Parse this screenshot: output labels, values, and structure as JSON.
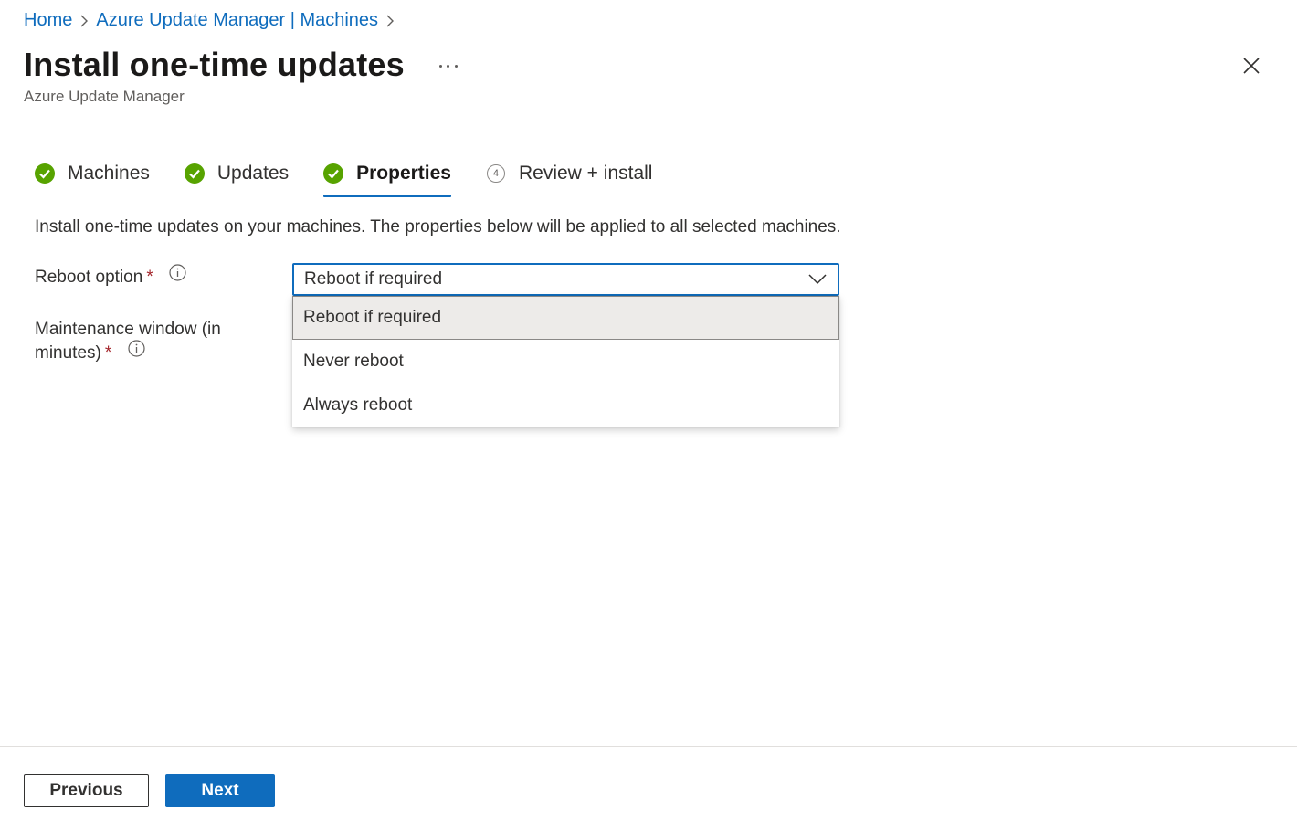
{
  "breadcrumb": {
    "items": [
      "Home",
      "Azure Update Manager | Machines"
    ]
  },
  "header": {
    "title": "Install one-time updates",
    "subtitle": "Azure Update Manager"
  },
  "steps": [
    {
      "label": "Machines",
      "status": "complete"
    },
    {
      "label": "Updates",
      "status": "complete"
    },
    {
      "label": "Properties",
      "status": "active"
    },
    {
      "label": "Review + install",
      "status": "pending",
      "number": "4"
    }
  ],
  "intro": "Install one-time updates on your machines. The properties below will be applied to all selected machines.",
  "form": {
    "reboot_label": "Reboot option",
    "maintenance_label_line1": "Maintenance window (in",
    "maintenance_label_line2": "minutes)",
    "required_mark": "*",
    "reboot_value": "Reboot if required",
    "reboot_options": [
      "Reboot if required",
      "Never reboot",
      "Always reboot"
    ]
  },
  "footer": {
    "previous_label": "Previous",
    "next_label": "Next"
  },
  "colors": {
    "accent": "#0f6cbd",
    "success": "#57a300",
    "required": "#a4262c"
  }
}
